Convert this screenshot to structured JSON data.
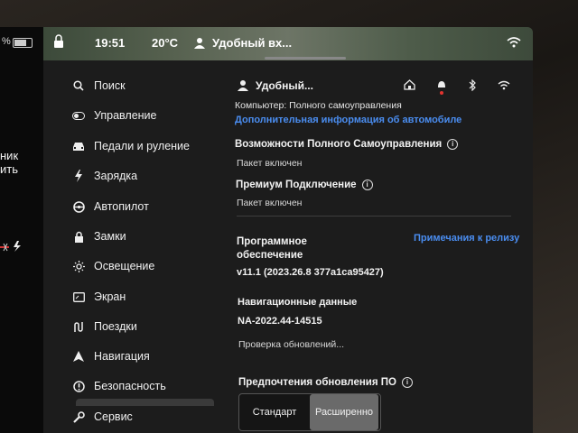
{
  "status_bar": {
    "left_battery": "%",
    "time": "19:51",
    "temperature": "20°C",
    "profile": "Удобный вх..."
  },
  "left_strip": {
    "line1": "ник",
    "line2": "ить"
  },
  "sidebar": {
    "items": [
      {
        "label": "Поиск",
        "icon": "search-icon"
      },
      {
        "label": "Управление",
        "icon": "toggle-icon"
      },
      {
        "label": "Педали и руление",
        "icon": "car-icon"
      },
      {
        "label": "Зарядка",
        "icon": "lightning-icon"
      },
      {
        "label": "Автопилот",
        "icon": "steering-wheel-icon"
      },
      {
        "label": "Замки",
        "icon": "lock-icon"
      },
      {
        "label": "Освещение",
        "icon": "sun-icon"
      },
      {
        "label": "Экран",
        "icon": "display-icon"
      },
      {
        "label": "Поездки",
        "icon": "trips-icon"
      },
      {
        "label": "Навигация",
        "icon": "navigation-icon"
      },
      {
        "label": "Безопасность",
        "icon": "safety-icon"
      },
      {
        "label": "Сервис",
        "icon": "wrench-icon"
      }
    ]
  },
  "header": {
    "profile_name": "Удобный..."
  },
  "software": {
    "computer_label": "Компьютер: Полного самоуправления",
    "more_info_link": "Дополнительная информация об автомобиле",
    "fsd_title": "Возможности Полного Самоуправления",
    "fsd_status": "Пакет включен",
    "premium_title": "Премиум Подключение",
    "premium_status": "Пакет включен",
    "software_title_1": "Программное",
    "software_title_2": "обеспечение",
    "release_notes_link": "Примечания к релизу",
    "version": "v11.1 (2023.26.8 377a1ca95427)",
    "nav_data_title": "Навигационные данные",
    "nav_data_version": "NA-2022.44-14515",
    "check_updates": "Проверка обновлений...",
    "update_pref_title": "Предпочтения обновления ПО",
    "option_standard": "Стандарт",
    "option_advanced": "Расширенно",
    "selected_option": "Расширенно"
  },
  "colors": {
    "accent_link": "#4a8df0",
    "notification_dot": "#e3342f"
  }
}
